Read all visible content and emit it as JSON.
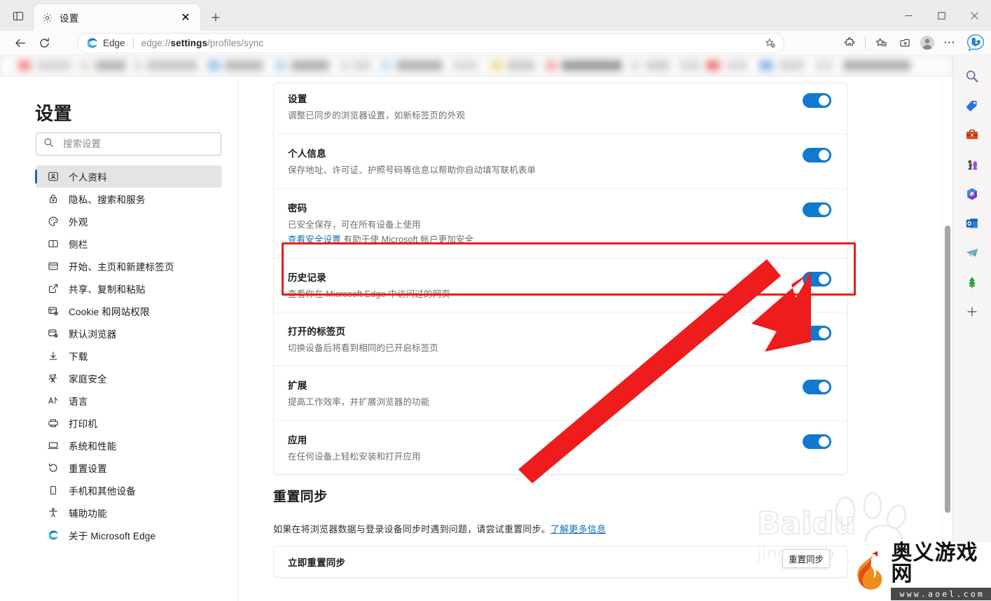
{
  "window": {
    "tab_actions_icon": "tab-list-icon",
    "minimize_label": "─",
    "maximize_label": "□",
    "close_label": "✕",
    "new_tab_label": "+"
  },
  "tab": {
    "title": "设置",
    "favicon": "gear-icon",
    "close_label": "✕"
  },
  "toolbar": {
    "back_icon": "back-arrow-icon",
    "refresh_icon": "refresh-icon",
    "brand_label": "Edge",
    "address_prefix": "edge://",
    "address_bold": "settings",
    "address_suffix": "/profiles/sync",
    "address_full": "edge://settings/profiles/sync",
    "favorite_add_icon": "star-plus-icon",
    "extensions_icon": "puzzle-icon",
    "favorites_icon": "favorites-star-icon",
    "collections_icon": "collections-icon",
    "profile_icon": "avatar-icon",
    "more_label": "⋯",
    "copilot_icon": "bing-copilot-icon"
  },
  "sidebar": {
    "title": "设置",
    "search_placeholder": "搜索设置",
    "search_value": "",
    "search_icon": "search-icon",
    "items": [
      {
        "label": "个人资料",
        "icon": "profile-icon",
        "active": true
      },
      {
        "label": "隐私、搜索和服务",
        "icon": "lock-icon",
        "active": false
      },
      {
        "label": "外观",
        "icon": "palette-icon",
        "active": false
      },
      {
        "label": "侧栏",
        "icon": "sidebar-icon",
        "active": false
      },
      {
        "label": "开始、主页和新建标签页",
        "icon": "home-icon",
        "active": false
      },
      {
        "label": "共享、复制和粘贴",
        "icon": "share-icon",
        "active": false
      },
      {
        "label": "Cookie 和网站权限",
        "icon": "cookie-icon",
        "active": false
      },
      {
        "label": "默认浏览器",
        "icon": "default-browser-icon",
        "active": false
      },
      {
        "label": "下载",
        "icon": "download-icon",
        "active": false
      },
      {
        "label": "家庭安全",
        "icon": "family-icon",
        "active": false
      },
      {
        "label": "语言",
        "icon": "language-icon",
        "active": false
      },
      {
        "label": "打印机",
        "icon": "printer-icon",
        "active": false
      },
      {
        "label": "系统和性能",
        "icon": "system-icon",
        "active": false
      },
      {
        "label": "重置设置",
        "icon": "reset-icon",
        "active": false
      },
      {
        "label": "手机和其他设备",
        "icon": "phone-icon",
        "active": false
      },
      {
        "label": "辅助功能",
        "icon": "accessibility-icon",
        "active": false
      },
      {
        "label": "关于 Microsoft Edge",
        "icon": "edge-logo-icon",
        "active": false
      }
    ]
  },
  "sync": {
    "rows": [
      {
        "title": "设置",
        "desc": "调整已同步的浏览器设置，如新标签页的外观",
        "toggle_on": true
      },
      {
        "title": "个人信息",
        "desc": "保存地址、许可证、护照号码等信息以帮助你自动填写联机表单",
        "toggle_on": true
      },
      {
        "title": "密码",
        "desc": "已安全保存，可在所有设备上使用",
        "desc_link": "查看安全设置",
        "desc_after_link": " 有助于使 Microsoft 帐户更加安全",
        "toggle_on": true
      },
      {
        "title": "历史记录",
        "desc": "查看你在 Microsoft Edge 中访问过的网页",
        "toggle_on": true,
        "highlighted": true
      },
      {
        "title": "打开的标签页",
        "desc": "切换设备后将看到相同的已开启标签页",
        "toggle_on": true
      },
      {
        "title": "扩展",
        "desc": "提高工作效率，并扩展浏览器的功能",
        "toggle_on": true
      },
      {
        "title": "应用",
        "desc": "在任何设备上轻松安装和打开应用",
        "toggle_on": true
      }
    ]
  },
  "reset_sync": {
    "heading": "重置同步",
    "desc": "如果在将浏览器数据与登录设备同步时遇到问题，请尝试重置同步。",
    "desc_link": "了解更多信息",
    "button_label": "立即重置同步"
  },
  "tooltip": {
    "text": "重置同步"
  },
  "edge_bar": {
    "items": [
      {
        "icon": "search-icon",
        "glyph": "🔍"
      },
      {
        "icon": "shopping-tag-icon",
        "glyph": "🏷️"
      },
      {
        "icon": "tools-briefcase-icon",
        "glyph": "🧰"
      },
      {
        "icon": "games-icon",
        "glyph": "♟️"
      },
      {
        "icon": "microsoft365-icon",
        "glyph": ""
      },
      {
        "icon": "outlook-icon",
        "glyph": ""
      },
      {
        "icon": "telegram-icon",
        "glyph": ""
      },
      {
        "icon": "tree-icon",
        "glyph": "🌲"
      },
      {
        "icon": "add-icon",
        "glyph": "＋"
      }
    ]
  },
  "watermark": {
    "baidu_text": "Baidu",
    "baidu_sub": "jingyan.b",
    "site_title": "奥义游戏网",
    "site_url": "www.aoel.com"
  },
  "colors": {
    "accent": "#0f6cbd",
    "toggle_on": "#0f7ad0",
    "annotation_red": "#ee1c1c",
    "chrome_bg": "#eceaea",
    "toolbar_bg": "#fbfbfb"
  }
}
